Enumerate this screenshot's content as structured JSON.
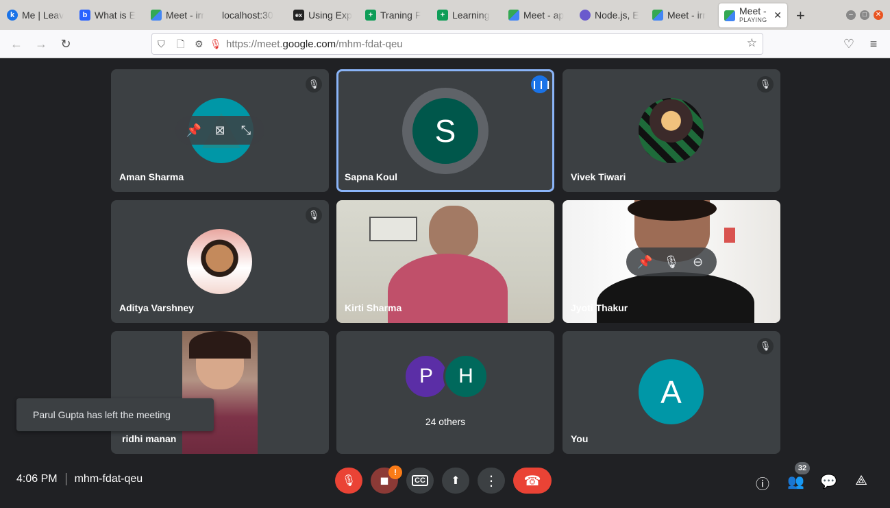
{
  "browser": {
    "tabs": [
      {
        "label": "Me | Leav",
        "fav": "k",
        "fav_color": "#1a73e8"
      },
      {
        "label": "What is E",
        "fav": "b",
        "fav_color": "#2962ff"
      },
      {
        "label": "Meet - irr",
        "fav": "",
        "fav_color": "#34a853"
      },
      {
        "label": "localhost:30",
        "fav": "",
        "fav_color": "transparent"
      },
      {
        "label": "Using Exp",
        "fav": "ex",
        "fav_color": "#222222"
      },
      {
        "label": "Traning F",
        "fav": "+",
        "fav_color": "#0f9d58"
      },
      {
        "label": "Learning",
        "fav": "+",
        "fav_color": "#0f9d58"
      },
      {
        "label": "Meet - ap",
        "fav": "",
        "fav_color": "#34a853"
      },
      {
        "label": "Node.js, E",
        "fav": "",
        "fav_color": "#6a5acd"
      },
      {
        "label": "Meet - irr",
        "fav": "",
        "fav_color": "#34a853"
      }
    ],
    "active_tab": {
      "label": "Meet -",
      "sub": "PLAYING"
    },
    "url": {
      "prefix": "https://meet.",
      "domain": "google.com",
      "path": "/mhm-fdat-qeu"
    }
  },
  "tiles": [
    {
      "name": "Aman Sharma",
      "muted": true
    },
    {
      "name": "Sapna Koul",
      "initial": "S",
      "speaking": true
    },
    {
      "name": "Vivek Tiwari",
      "muted": true
    },
    {
      "name": "Aditya Varshney",
      "muted": true
    },
    {
      "name": "Kirti Sharma"
    },
    {
      "name": "Jyoti Thakur"
    },
    {
      "name": "ridhi manan"
    },
    {
      "name": "24 others",
      "initials": [
        "P",
        "H"
      ]
    },
    {
      "name": "You",
      "initial": "A",
      "muted": true
    }
  ],
  "toast": "Parul Gupta has left the meeting",
  "meeting": {
    "time": "4:06 PM",
    "code": "mhm-fdat-qeu"
  },
  "participants_count": "32",
  "colors": {
    "leave": "#ea4335",
    "speaking": "#8ab4f8",
    "you_avatar": "#0097a7",
    "sapna_avatar": "#00574b"
  }
}
